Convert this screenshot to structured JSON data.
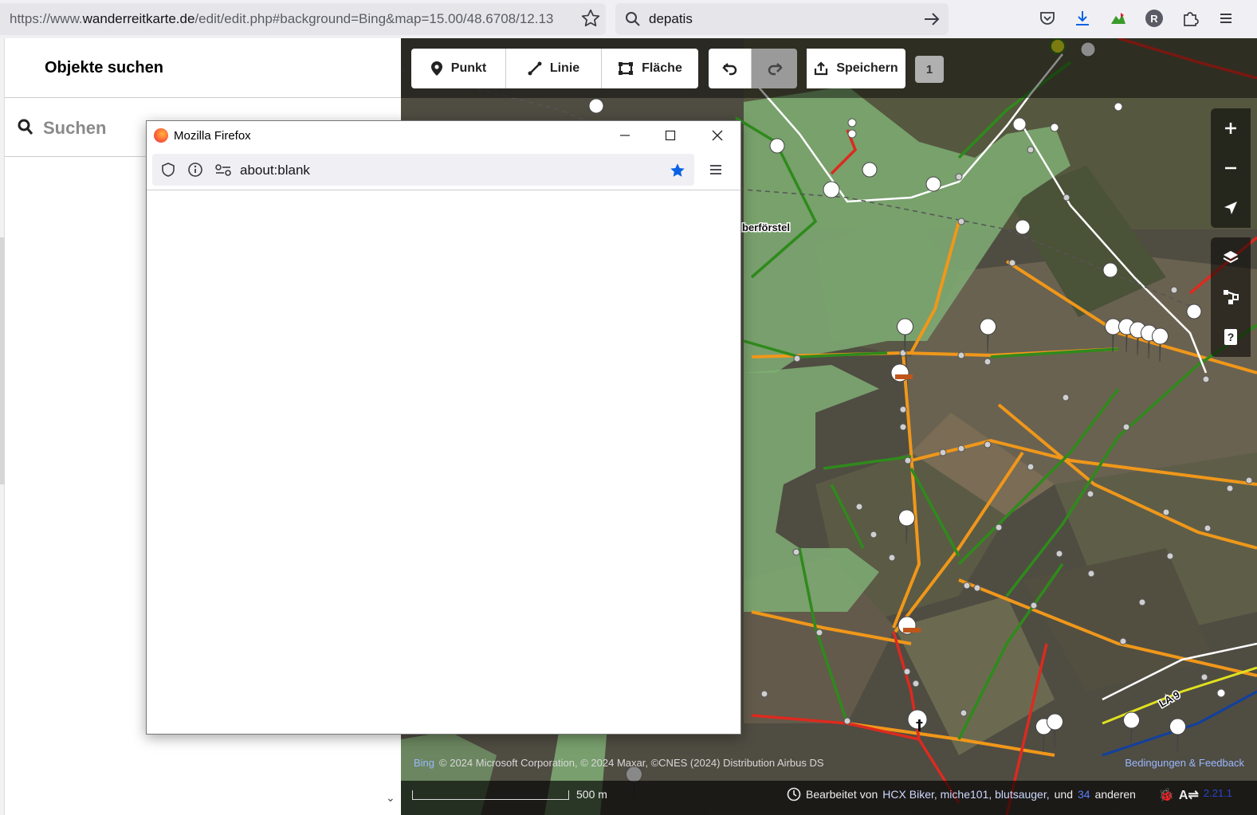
{
  "browser": {
    "url_prefix": "https://www.",
    "url_domain": "wanderreitkarte.de",
    "url_rest": "/edit/edit.php#background=Bing&map=15.00/48.6708/12.13",
    "search_value": "depatis",
    "profile_initial": "R"
  },
  "panel": {
    "title": "Objekte suchen",
    "search_placeholder": "Suchen"
  },
  "toolbar": {
    "point_label": "Punkt",
    "line_label": "Linie",
    "area_label": "Fläche",
    "save_label": "Speichern",
    "pending_count": "1"
  },
  "map": {
    "place_label": "berförstel",
    "road_label": "LA 9",
    "attribution_provider": "Bing",
    "attribution_text": "© 2024 Microsoft Corporation, © 2024 Maxar, ©CNES (2024) Distribution Airbus DS",
    "feedback_link": "Bedingungen & Feedback",
    "scale_label": "500 m",
    "edited_by_prefix": "Bearbeitet von",
    "editors": "HCX Biker, miche101, blutsauger,",
    "and_word": "und",
    "others_count": "34",
    "others_word": "anderen",
    "version": "2.21.1"
  },
  "popup": {
    "window_title": "Mozilla Firefox",
    "address": "about:blank"
  },
  "colors": {
    "forest": "#7fae74",
    "path_orange": "#f0971a",
    "path_green": "#2f8a1c",
    "path_red": "#dd2a1f",
    "bookmark_blue": "#0a62e6"
  }
}
